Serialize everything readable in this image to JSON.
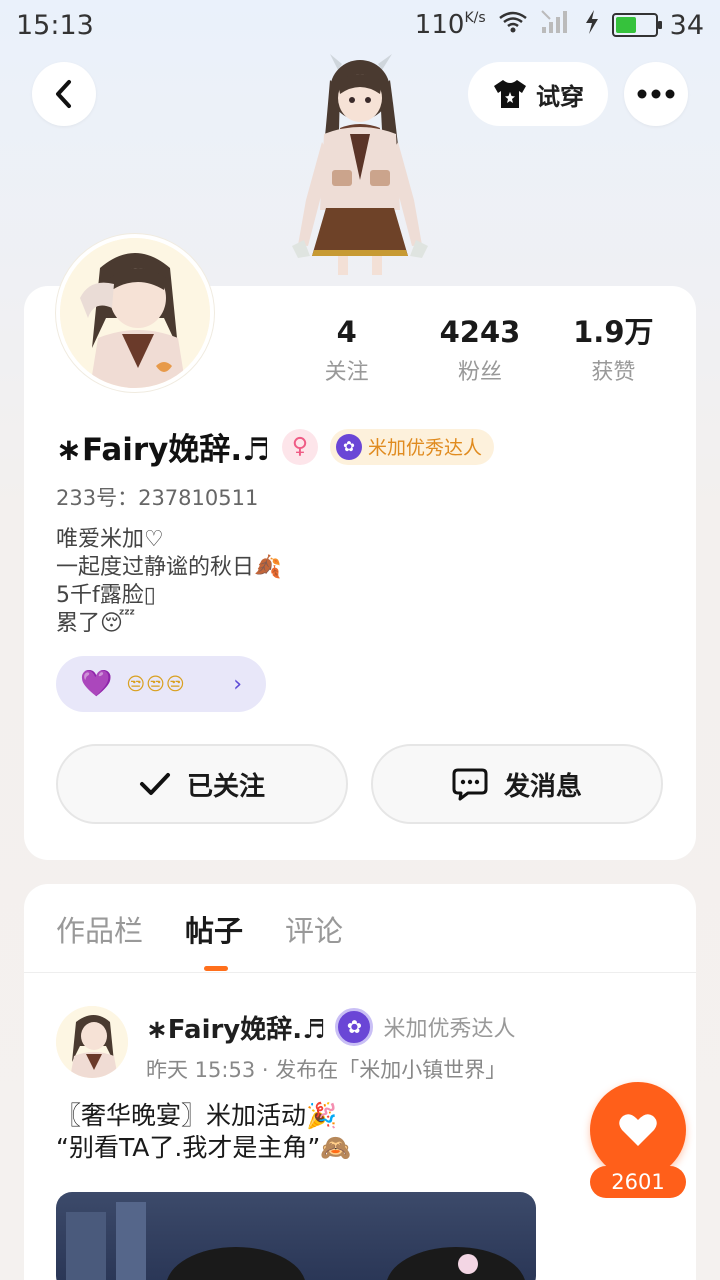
{
  "status": {
    "time": "15:13",
    "speed": "110",
    "speed_unit": "K/s",
    "battery": "34",
    "battery_level": 0.34
  },
  "header": {
    "try_on_label": "试穿"
  },
  "profile": {
    "stats": [
      {
        "num": "4",
        "label": "关注"
      },
      {
        "num": "4243",
        "label": "粉丝"
      },
      {
        "num": "1.9万",
        "label": "获赞"
      }
    ],
    "username": "∗Fairy娩辞.♬",
    "talent_label": "米加优秀达人",
    "user_id": "233号：237810511",
    "bio": [
      "唯爱米加♡",
      "一起度过静谧的秋日🍂",
      "5千f露脸▯",
      "累了😴"
    ],
    "fan_emojis": "😒😒😒",
    "follow_label": "已关注",
    "message_label": "发消息"
  },
  "tabs": [
    {
      "label": "作品栏",
      "active": false
    },
    {
      "label": "帖子",
      "active": true
    },
    {
      "label": "评论",
      "active": false
    }
  ],
  "post": {
    "author": "∗Fairy娩辞.♬",
    "talent_label": "米加优秀达人",
    "meta": "昨天 15:53 · 发布在「米加小镇世界」",
    "line1": "〖奢华晚宴〗米加活动🎉",
    "line2": "“别看TA了.我才是主角”🙈"
  },
  "like_count": "2601",
  "colors": {
    "accent": "#ff5f1a",
    "talent_purple": "#6a46d6",
    "badge_orange": "#e08b1f"
  }
}
